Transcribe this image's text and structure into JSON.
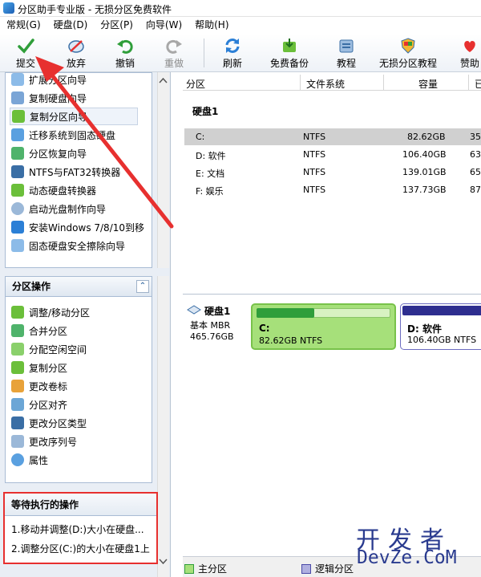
{
  "window": {
    "title": "分区助手专业版 - 无损分区免费软件"
  },
  "menu": [
    "常规(G)",
    "硬盘(D)",
    "分区(P)",
    "向导(W)",
    "帮助(H)"
  ],
  "toolbar": {
    "commit": "提交",
    "discard": "放弃",
    "undo": "撤销",
    "redo": "重做",
    "refresh": "刷新",
    "free_backup": "免费备份",
    "tutorial": "教程",
    "lossless_tutorial": "无损分区教程",
    "sponsor": "赞助"
  },
  "wizards": [
    "扩展分区向导",
    "复制硬盘向导",
    "复制分区向导",
    "迁移系统到固态硬盘",
    "分区恢复向导",
    "NTFS与FAT32转换器",
    "动态硬盘转换器",
    "启动光盘制作向导",
    "安装Windows 7/8/10到移",
    "固态硬盘安全擦除向导"
  ],
  "partition_ops": {
    "header": "分区操作",
    "items": [
      "调整/移动分区",
      "合并分区",
      "分配空闲空间",
      "复制分区",
      "更改卷标",
      "分区对齐",
      "更改分区类型",
      "更改序列号",
      "属性"
    ]
  },
  "pending": {
    "header": "等待执行的操作",
    "items": [
      "1.移动并调整(D:)大小在硬盘...",
      "2.调整分区(C:)的大小在硬盘1上"
    ]
  },
  "table": {
    "columns": [
      "分区",
      "文件系统",
      "容量",
      "已"
    ],
    "disk_label": "硬盘1",
    "rows": [
      {
        "name": "C:",
        "fs": "NTFS",
        "cap": "82.62GB",
        "used": "35."
      },
      {
        "name": "D: 软件",
        "fs": "NTFS",
        "cap": "106.40GB",
        "used": "63."
      },
      {
        "name": "E: 文档",
        "fs": "NTFS",
        "cap": "139.01GB",
        "used": "65."
      },
      {
        "name": "F: 娱乐",
        "fs": "NTFS",
        "cap": "137.73GB",
        "used": "87."
      }
    ]
  },
  "diskmap": {
    "disk": {
      "name": "硬盘1",
      "type": "基本 MBR",
      "size": "465.76GB"
    },
    "partitions": [
      {
        "name": "C:",
        "size": "82.62GB NTFS",
        "color": "#9be36a"
      },
      {
        "name": "D: 软件",
        "size": "106.40GB NTFS",
        "color": "#2e2e8f"
      }
    ]
  },
  "legend": {
    "primary": "主分区",
    "logical": "逻辑分区"
  },
  "colors": {
    "accent": "#3a6ea5",
    "highlight": "#e7302f",
    "primary_partition": "#2f9e3a",
    "logical_partition": "#4a4aa8"
  },
  "watermark": {
    "line1": "开发者",
    "line2": "DevZe.CoM"
  }
}
